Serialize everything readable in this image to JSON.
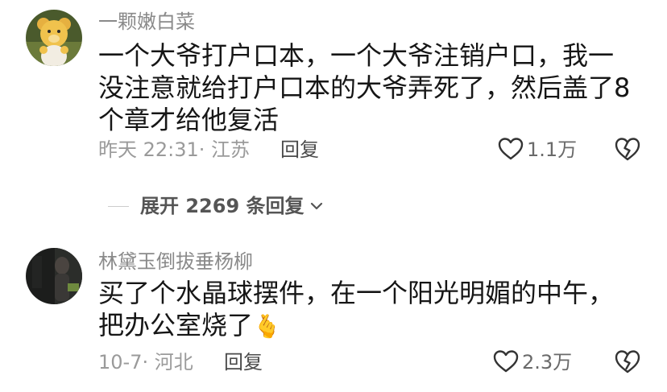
{
  "comments": [
    {
      "username": "一颗嫩白菜",
      "text": "一个大爷打户口本，一个大爷注销户口，我一没注意就给打户口本的大爷弄死了，然后盖了8个章才给他复活",
      "meta": "昨天 22:31· 江苏",
      "reply_label": "回复",
      "like_count": "1.1万",
      "avatar_icon": "teddy-bear-avatar"
    },
    {
      "username": "林黛玉倒拔垂杨柳",
      "text": "买了个水晶球摆件，在一个阳光明媚的中午，把办公室烧了",
      "emoji": "🫰",
      "meta": "10-7· 河北",
      "reply_label": "回复",
      "like_count": "2.3万",
      "avatar_icon": "dark-photo-avatar"
    }
  ],
  "expand": {
    "label": "展开 2269 条回复"
  },
  "colors": {
    "text": "#161616",
    "meta": "#9a9a9a",
    "username": "#8a8a8a"
  }
}
